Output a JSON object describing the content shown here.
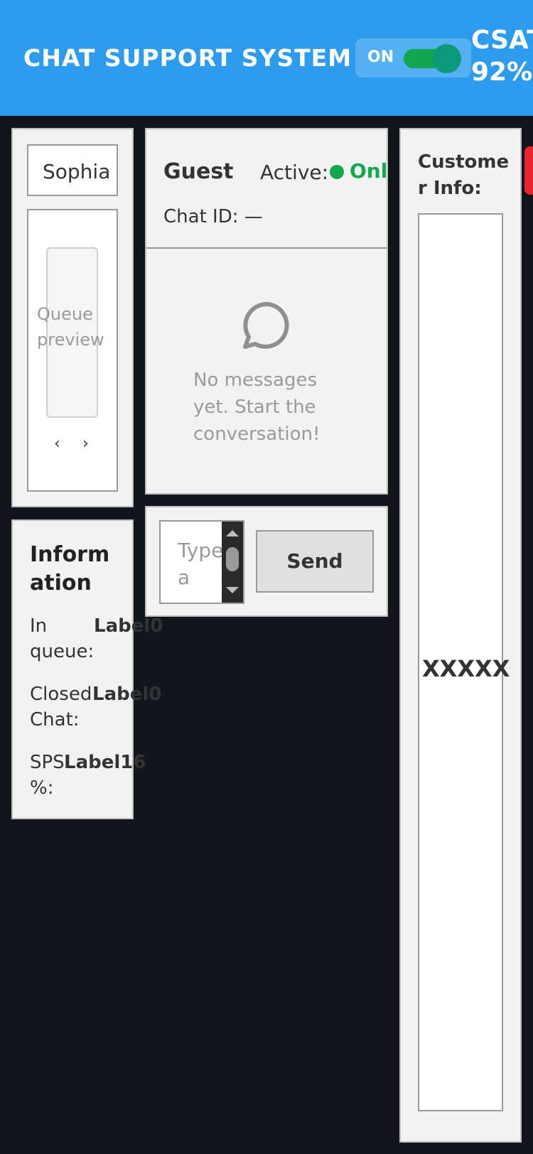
{
  "header": {
    "title": "CHAT SUPPORT SYSTEM",
    "toggle_label": "ON",
    "csat_label": "CSAT",
    "csat_value": "92%",
    "colors": {
      "header_bg": "#2e9bec",
      "toggle_on": "#12a84d"
    }
  },
  "queue": {
    "agent_name": "Sophia",
    "preview_text": "Queue preview",
    "prev_label": "‹",
    "next_label": "›"
  },
  "info": {
    "title": "Information",
    "rows": [
      {
        "key": "In queue:",
        "value": "Label0"
      },
      {
        "key": "Closed Chat:",
        "value": "Label0"
      },
      {
        "key": "SPS %:",
        "value": "Label16"
      }
    ]
  },
  "chat": {
    "guest_name": "Guest",
    "active_label": "Active:",
    "status": "Online",
    "chat_id": "Chat ID: —",
    "empty_icon": "chat-bubble-icon",
    "empty_message": "No messages yet. Start the conversation!"
  },
  "composer": {
    "placeholder": "Type a",
    "send_label": "Send"
  },
  "customer": {
    "title": "Customer Info:",
    "placeholder": "XXXXX"
  }
}
